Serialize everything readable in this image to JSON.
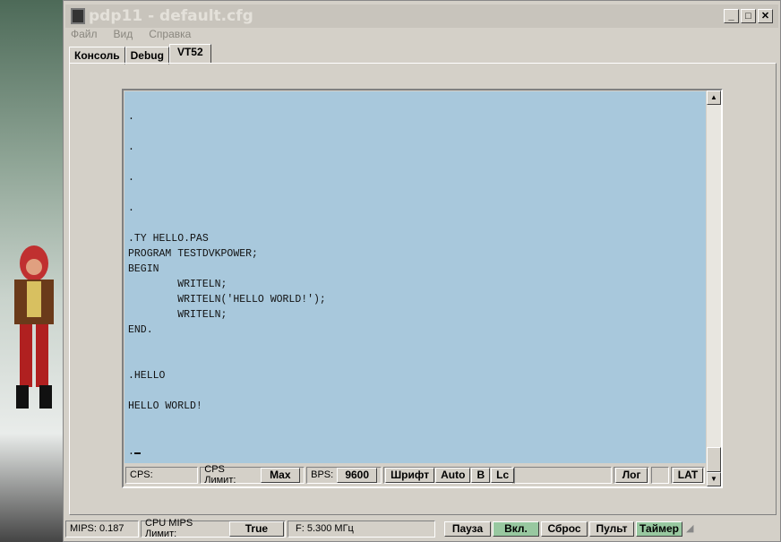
{
  "window": {
    "title": "pdp11 - default.cfg"
  },
  "menu": [
    "Файл",
    "Вид",
    "Справка"
  ],
  "tabs": [
    "Консоль",
    "Debug",
    "VT52"
  ],
  "terminal": {
    "lines": [
      ".",
      "",
      ".",
      "",
      ".",
      "",
      ".",
      "",
      ".TY HELLO.PAS",
      "PROGRAM TESTDVKPOWER;",
      "BEGIN",
      "        WRITELN;",
      "        WRITELN('HELLO WORLD!');",
      "        WRITELN;",
      "END.",
      "",
      "",
      ".HELLO",
      "",
      "HELLO WORLD!",
      "",
      "",
      "."
    ]
  },
  "term_status": {
    "cps": "CPS:",
    "cps_limit": "CPS Лимит:",
    "cps_limit_value": "Max",
    "bps": "BPS:",
    "bps_value": "9600",
    "font": "Шрифт",
    "auto": "Auto",
    "b": "B",
    "lc": "Lc",
    "log": "Лог",
    "lat": "LAT"
  },
  "status": {
    "mips": "MIPS:  0.187",
    "cpu_limit": "CPU MIPS Лимит:",
    "cpu_limit_value": "True",
    "freq": "F: 5.300 МГц",
    "pause": "Пауза",
    "power": "Вкл.",
    "reset": "Сброс",
    "panel": "Пульт",
    "timer": "Таймер"
  }
}
